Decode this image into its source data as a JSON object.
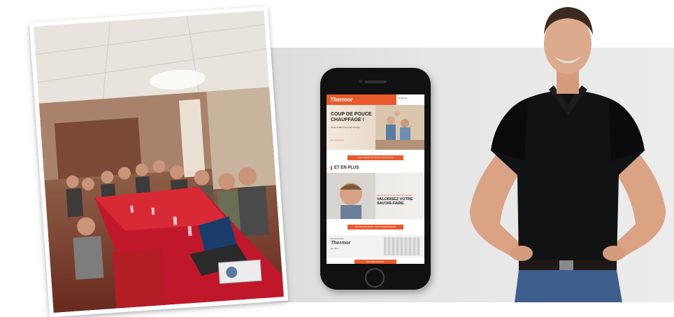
{
  "meeting_photo": {
    "subject": "group of people seated at a long table with red tablecloths, a laptop and a projector"
  },
  "phone_screen": {
    "logo": "Thermor",
    "header_info": "Newsletter",
    "hero": {
      "title": "COUP DE POUCE CHAUFFAGE !",
      "text": "Jusqu'à 800 € de prime énergie",
      "cta": "En savoir plus"
    },
    "hero_button": "C'EST PARTI POUR LE CHAUFFAGE",
    "section_title": "ET EN PLUS",
    "card": {
      "tag": "ÉLECTRICIENS & CHAUFFAGISTES",
      "title": "VALORISEZ VOTRE SAVOIR-FAIRE"
    },
    "card_button": "METTEZ EN AVANT VOS COMPÉTENCES",
    "footer": {
      "kicker": "RETROUVEZ",
      "logo": "Thermor",
      "text": "au salon ...",
      "button": "EN SAVOIR PLUS"
    }
  },
  "man_photo": {
    "subject": "smiling man in black polo shirt and jeans, hands on hips"
  },
  "colors": {
    "brand": "#e85a2c",
    "backdrop": "#e4e4e4",
    "phone_body": "#111111"
  }
}
